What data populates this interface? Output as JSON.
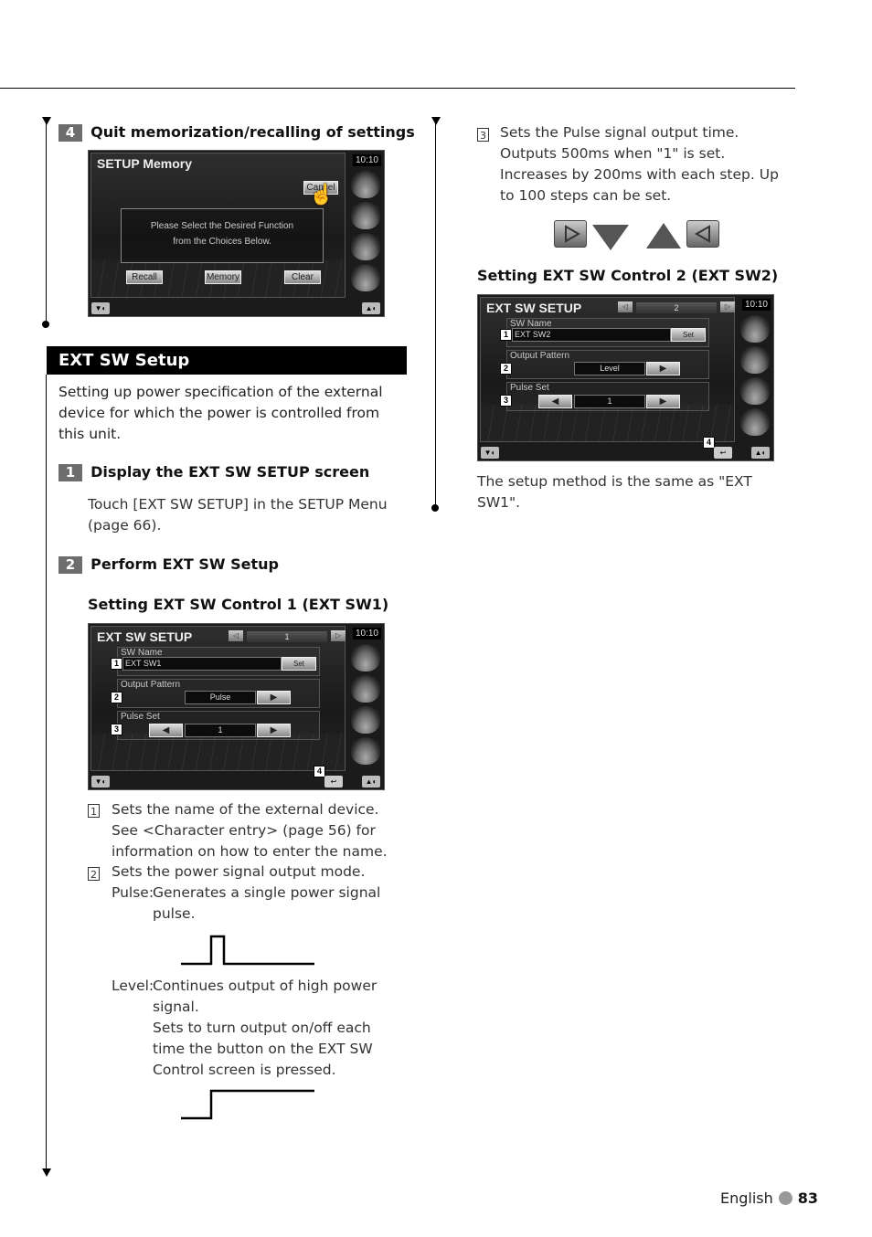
{
  "step4": {
    "num": "4",
    "title": "Quit memorization/recalling of settings"
  },
  "memory_screen": {
    "title": "SETUP Memory",
    "clock": "10:10",
    "cancel": "Cancel",
    "message_line1": "Please Select the Desired Function",
    "message_line2": "from the Choices Below.",
    "recall": "Recall",
    "memory": "Memory",
    "clear": "Clear"
  },
  "section": {
    "title": "EXT SW Setup",
    "intro": "Setting up power specification of the external device for which the power is controlled from this unit."
  },
  "step1": {
    "num": "1",
    "title": "Display the EXT SW SETUP screen",
    "body": "Touch [EXT SW SETUP] in the SETUP Menu (page 66)."
  },
  "step2": {
    "num": "2",
    "title": "Perform EXT SW Setup"
  },
  "sw1": {
    "heading": "Setting EXT SW Control 1 (EXT SW1)",
    "screen": {
      "title": "EXT SW SETUP",
      "page": "1",
      "clock": "10:10",
      "sw_name_label": "SW Name",
      "sw_name_value": "EXT SW1",
      "set": "Set",
      "output_pattern_label": "Output Pattern",
      "output_pattern_value": "Pulse",
      "pulse_set_label": "Pulse Set",
      "pulse_set_value": "1",
      "badges": [
        "1",
        "2",
        "3",
        "4"
      ]
    }
  },
  "notes": {
    "n1_num": "1",
    "n1": "Sets the name of the external device. See <Character entry> (page 56) for information on how to enter the name.",
    "n2_num": "2",
    "n2": "Sets the power signal output mode.",
    "pulse_label": "Pulse:",
    "pulse_desc": "Generates a single power signal pulse.",
    "level_label": "Level:",
    "level_desc1": "Continues output of high power signal.",
    "level_desc2": "Sets to turn output on/off each time the button on the EXT SW Control screen is pressed.",
    "n3_num": "3",
    "n3": "Sets the Pulse signal output time. Outputs 500ms when \"1\" is set. Increases by 200ms with each step. Up to 100 steps can be set."
  },
  "sw2": {
    "heading": "Setting EXT SW Control 2  (EXT SW2)",
    "screen": {
      "title": "EXT SW SETUP",
      "page": "2",
      "clock": "10:10",
      "sw_name_label": "SW Name",
      "sw_name_value": "EXT SW2",
      "set": "Set",
      "output_pattern_label": "Output Pattern",
      "output_pattern_value": "Level",
      "pulse_set_label": "Pulse Set",
      "pulse_set_value": "1",
      "badges": [
        "1",
        "2",
        "3",
        "4"
      ]
    },
    "note": "The setup method is the same as \"EXT SW1\"."
  },
  "icons": [
    "right-arrow-button-icon",
    "down-triangle-icon",
    "up-triangle-icon",
    "left-arrow-button-icon"
  ],
  "footer": {
    "language": "English",
    "page": "83"
  }
}
